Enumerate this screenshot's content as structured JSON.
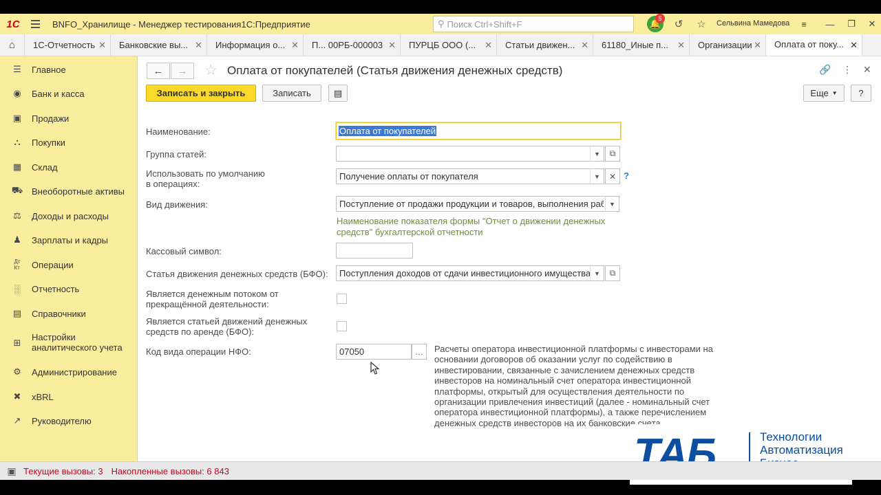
{
  "app": {
    "title": "BNFO_Хранилище  - Менеджер тестирования1С:Предприятие",
    "search_placeholder": "Поиск Ctrl+Shift+F",
    "notifications_count": "5",
    "user": "Сельвина Мамедова"
  },
  "tabs": [
    {
      "label": "1С-Отчетность"
    },
    {
      "label": "Банковские вы..."
    },
    {
      "label": "Информация о..."
    },
    {
      "label": "П... 00РБ-000003"
    },
    {
      "label": "ПУРЦБ ООО (..."
    },
    {
      "label": "Статьи движен..."
    },
    {
      "label": "61180_Иные п..."
    },
    {
      "label": "Организации"
    },
    {
      "label": "Оплата от поку..."
    }
  ],
  "sidebar": {
    "items": [
      {
        "label": "Главное",
        "icon": "menu-icon"
      },
      {
        "label": "Банк и касса",
        "icon": "bank-icon"
      },
      {
        "label": "Продажи",
        "icon": "bag-icon"
      },
      {
        "label": "Покупки",
        "icon": "cart-icon"
      },
      {
        "label": "Склад",
        "icon": "warehouse-icon"
      },
      {
        "label": "Внеоборотные активы",
        "icon": "truck-icon"
      },
      {
        "label": "Доходы и расходы",
        "icon": "scales-icon"
      },
      {
        "label": "Зарплаты и кадры",
        "icon": "person-icon"
      },
      {
        "label": "Операции",
        "icon": "dt-kt-icon"
      },
      {
        "label": "Отчетность",
        "icon": "bar-chart-icon"
      },
      {
        "label": "Справочники",
        "icon": "book-icon"
      },
      {
        "label": "Настройки аналитического учета",
        "icon": "hierarchy-icon"
      },
      {
        "label": "Администрирование",
        "icon": "gear-icon"
      },
      {
        "label": "xBRL",
        "icon": "xbrl-icon"
      },
      {
        "label": "Руководителю",
        "icon": "trend-icon"
      }
    ]
  },
  "form": {
    "title": "Оплата от покупателей (Статья движения денежных средств)",
    "buttons": {
      "save_close": "Записать и закрыть",
      "save": "Записать",
      "more": "Еще",
      "help": "?"
    },
    "fields": {
      "name_label": "Наименование:",
      "name_value": "Оплата от покупателей",
      "group_label": "Группа статей:",
      "group_value": "",
      "default_use_label": "Использовать по умолчанию в операциях:",
      "default_use_value": "Получение оплаты от покупателя",
      "movement_type_label": "Вид движения:",
      "movement_type_value": "Поступление от продажи продукции и товаров, выполнения раб",
      "movement_hint": "Наименование показателя формы \"Отчет о движении денежных средств\" бухгалтерской отчетности",
      "cash_symbol_label": "Кассовый символ:",
      "cash_symbol_value": "",
      "bfo_item_label": "Статья движения денежных средств (БФО):",
      "bfo_item_value": "Поступления доходов от сдачи инвестиционного имущества",
      "discontinued_label": "Является денежным потоком от прекращённой деятельности:",
      "lease_label": "Является статьей движений денежных средств по аренде (БФО):",
      "nfo_code_label": "Код вида операции НФО:",
      "nfo_code_value": "07050",
      "nfo_description": "Расчеты оператора инвестиционной платформы с инвесторами на основании договоров об оказании услуг по содействию в инвестировании, связанные с зачислением денежных средств инвесторов на номинальный счет оператора инвестиционной платформы, открытый для осуществления деятельности по организации привлечения инвестиций (далее - номинальный счет оператора инвестиционной платформы), а также перечислением денежных средств инвесторов на их банковские счета"
    }
  },
  "logo": {
    "mark": "ТАБ",
    "line1": "Технологии",
    "line2": "Автоматизация",
    "line3": "Бизнес"
  },
  "status": {
    "current_calls": "Текущие вызовы: 3",
    "accumulated_calls": "Накопленные вызовы: 6 843"
  }
}
